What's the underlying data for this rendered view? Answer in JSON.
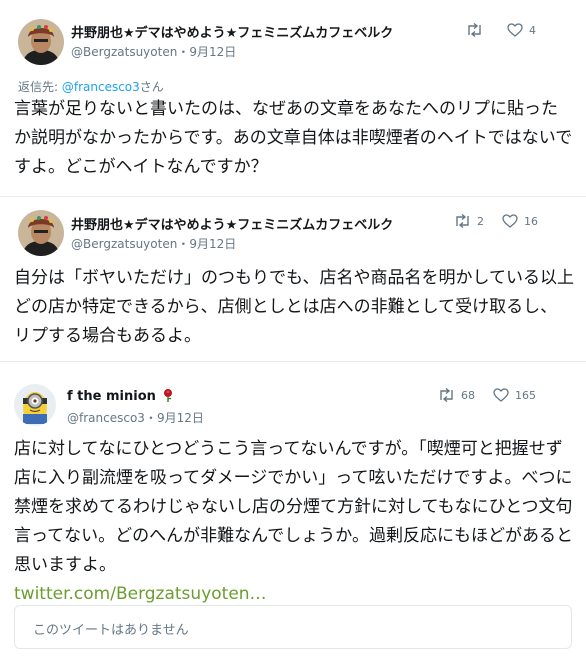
{
  "tweets": [
    {
      "author_name": "井野朋也★デマはやめよう★フェミニズムカフェベルク",
      "handle": "@Bergzatsuyoten",
      "date": "9月12日",
      "retweets": "",
      "likes": "4",
      "reply_to_label": "返信先: ",
      "reply_to_handle": "@francesco3",
      "reply_to_suffix": "さん",
      "text": "言葉が足りないと書いたのは、なぜあの文章をあなたへのリプに貼ったか説明がなかったからです。あの文章自体は非喫煙者のヘイトではないですよ。どこがヘイトなんですか？"
    },
    {
      "author_name": "井野朋也★デマはやめよう★フェミニズムカフェベルク",
      "handle": "@Bergzatsuyoten",
      "date": "9月12日",
      "retweets": "2",
      "likes": "16",
      "text": "自分は「ボヤいただけ」のつもりでも、店名や商品名を明かしている以上どの店か特定できるから、店側としとは店への非難として受け取るし、リプする場合もあるよ。"
    },
    {
      "author_name": "f the minion",
      "handle": "@francesco3",
      "date": "9月12日",
      "retweets": "68",
      "likes": "165",
      "text": "店に対してなにひとつどうこう言ってないんですが。「喫煙可と把握せず店に入り副流煙を吸ってダメージでかい」って呟いただけですよ。べつに禁煙を求めてるわけじゃないし店の分煙て方針に対してもなにひとつ文句言ってない。どのへんが非難なんでしょうか。過剰反応にもほどがあると思いますよ。",
      "link": "twitter.com/Bergzatsuyoten…",
      "quote_unavailable": "このツイートはありません"
    }
  ],
  "separator": "・",
  "colors": {
    "name": "#14171a",
    "meta": "#657786",
    "accent": "#1da1f2",
    "link": "#6a9e2e",
    "rose": "#c0161f"
  },
  "icons": [
    "retweet-icon",
    "heart-icon",
    "rose-icon"
  ]
}
